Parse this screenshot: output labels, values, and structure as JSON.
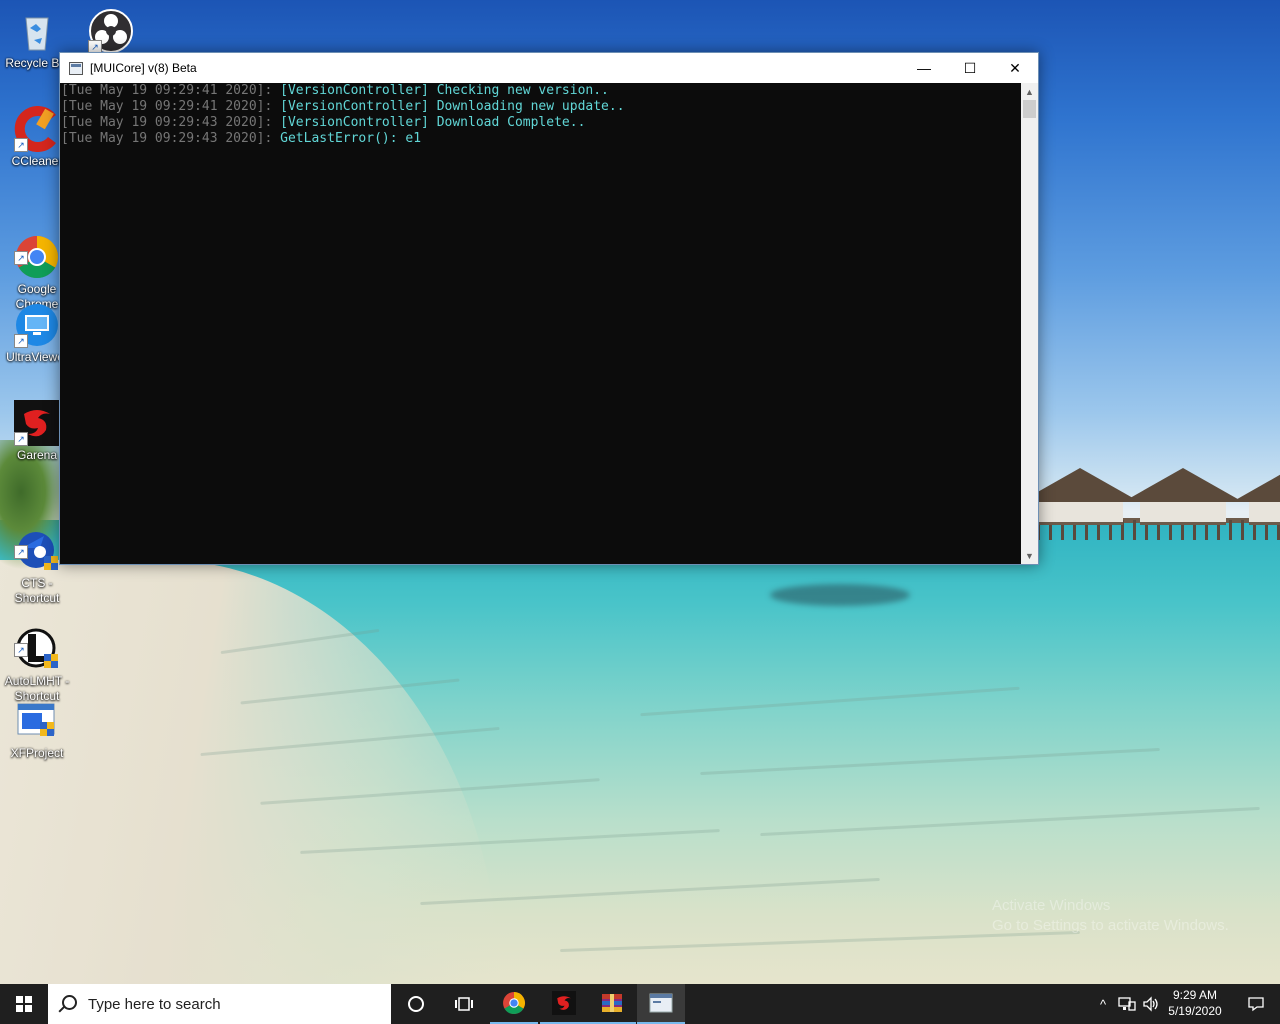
{
  "desktop": {
    "icons": [
      {
        "label": "Recycle Bin",
        "icon": "recycle-bin-icon"
      },
      {
        "label": "",
        "icon": "obs-icon"
      },
      {
        "label": "CCleaner",
        "icon": "ccleaner-icon"
      },
      {
        "label": "Google\nChrome",
        "icon": "chrome-icon"
      },
      {
        "label": "UltraViewer",
        "icon": "ultraviewer-icon"
      },
      {
        "label": "Garena",
        "icon": "garena-icon"
      },
      {
        "label": "CTS -\nShortcut",
        "icon": "cts-icon"
      },
      {
        "label": "AutoLMHT -\nShortcut",
        "icon": "autolmht-icon"
      },
      {
        "label": "XFProject",
        "icon": "xfproject-icon"
      }
    ],
    "watermark_line1": "Activate Windows",
    "watermark_line2": "Go to Settings to activate Windows."
  },
  "window": {
    "title": "[MUICore] v(8) Beta",
    "minimize_glyph": "—",
    "maximize_glyph": "☐",
    "close_glyph": "✕",
    "console_lines": [
      {
        "ts": "[Tue May 19 09:29:41 2020]: ",
        "msg": "[VersionController] Checking new version.."
      },
      {
        "ts": "[Tue May 19 09:29:41 2020]: ",
        "msg": "[VersionController] Downloading new update.."
      },
      {
        "ts": "[Tue May 19 09:29:43 2020]: ",
        "msg": "[VersionController] Download Complete.."
      },
      {
        "ts": "[Tue May 19 09:29:43 2020]: ",
        "msg": "GetLastError(): e1"
      }
    ],
    "colors": {
      "timestamp": "#767676",
      "message": "#61d6d6",
      "background": "#0c0c0c"
    }
  },
  "taskbar": {
    "search_placeholder": "Type here to search",
    "pinned": [
      {
        "name": "cortana-icon"
      },
      {
        "name": "task-view-icon"
      },
      {
        "name": "chrome-icon"
      },
      {
        "name": "garena-icon"
      },
      {
        "name": "winrar-icon"
      },
      {
        "name": "console-app-icon"
      }
    ],
    "tray": {
      "chevron": "^",
      "time": "9:29 AM",
      "date": "5/19/2020"
    },
    "accent": "#76b9ed"
  }
}
